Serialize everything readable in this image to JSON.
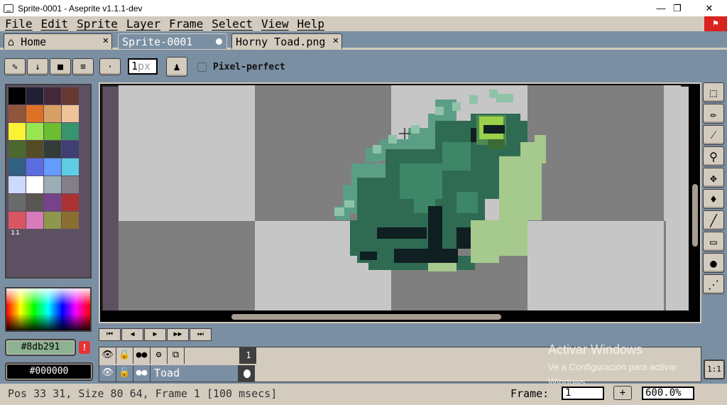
{
  "window": {
    "title": "Sprite-0001 - Aseprite v1.1.1-dev",
    "minimize": "—",
    "maximize": "❐",
    "close": "✕"
  },
  "menu": [
    "File",
    "Edit",
    "Sprite",
    "Layer",
    "Frame",
    "Select",
    "View",
    "Help"
  ],
  "tabs": [
    {
      "label": "Home",
      "icon": "home-icon",
      "close": "✕"
    },
    {
      "label": "Sprite-0001",
      "active": true
    },
    {
      "label": "Horny Toad.png",
      "close": "✕"
    }
  ],
  "context_bar": {
    "brush_size_value": "1",
    "brush_size_unit": "px",
    "pixel_perfect_label": "Pixel-perfect",
    "pixel_perfect_checked": false
  },
  "palette": {
    "colors": [
      "#000000",
      "#222034",
      "#45283c",
      "#663931",
      "#8f563b",
      "#df7126",
      "#d9a066",
      "#eec39a",
      "#fbf236",
      "#99e550",
      "#6abe30",
      "#37946e",
      "#4b692f",
      "#524b24",
      "#323c39",
      "#3f3f74",
      "#306082",
      "#5b6ee1",
      "#639bff",
      "#5fcde4",
      "#cbdbfc",
      "#ffffff",
      "#9badb7",
      "#847e87",
      "#696a6a",
      "#595652",
      "#76428a",
      "#ac3232",
      "#d95763",
      "#d77bba",
      "#8f974a",
      "#8a6f30"
    ],
    "handle": "ıı"
  },
  "colors": {
    "foreground": "#8db291",
    "foreground_label": "#8db291",
    "background": "#000000",
    "background_label": "#000000",
    "warning": "!"
  },
  "tools": [
    "marquee-icon",
    "pencil-icon",
    "eyedropper-icon",
    "zoom-icon",
    "move-icon",
    "paint-bucket-icon",
    "line-icon",
    "rectangle-icon",
    "ellipse-icon",
    "blur-icon"
  ],
  "animation_controls": [
    "⏮",
    "◀",
    "▶",
    "▶▶",
    "⏭"
  ],
  "timeline": {
    "frame_number": "1",
    "layer_name": "Toad"
  },
  "watermark": {
    "title": "Activar Windows",
    "subtitle": "Ve a Configuración para activar Windows."
  },
  "status": {
    "text": "Pos 33 31, Size 80 64, Frame 1 [100 msecs]",
    "frame_label": "Frame:",
    "frame_value": "1",
    "plus": "+",
    "zoom": "600.0%"
  },
  "one_to_one": "1:1"
}
